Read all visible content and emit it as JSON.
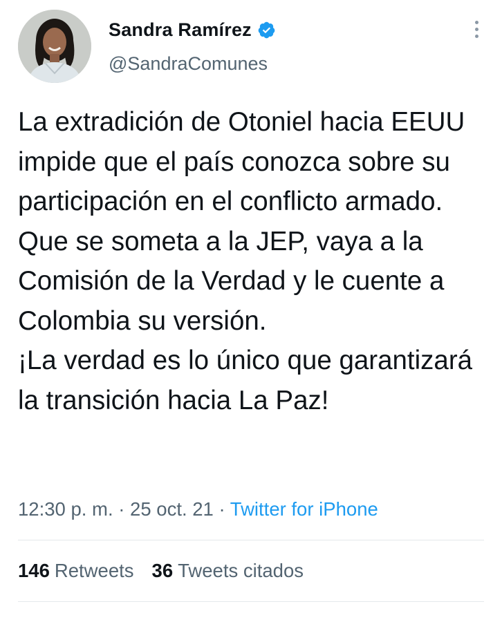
{
  "author": {
    "display_name": "Sandra Ramírez",
    "handle": "@SandraComunes",
    "verified": true,
    "verified_color": "#1d9bf0"
  },
  "tweet": {
    "text_main": "La extradición de Otoniel hacia EEUU impide que el país conozca sobre su participación en el conflicto armado. Que se someta a la JEP, vaya a la Comisión de la Verdad y le cuente a Colombia su versión.",
    "text_second": "¡La verdad es lo único que garantizará la transición hacia La Paz!",
    "time": "12:30 p. m.",
    "separator": " · ",
    "date": "25 oct. 21",
    "source": "Twitter for iPhone"
  },
  "stats": {
    "retweets_count": "146",
    "retweets_label": "Retweets",
    "quotes_count": "36",
    "quotes_label": "Tweets citados"
  },
  "icons": {
    "more": "more-vertical-icon",
    "verified": "verified-badge-icon"
  },
  "colors": {
    "text": "#0f1419",
    "secondary": "#536471",
    "link": "#1d9bf0"
  }
}
